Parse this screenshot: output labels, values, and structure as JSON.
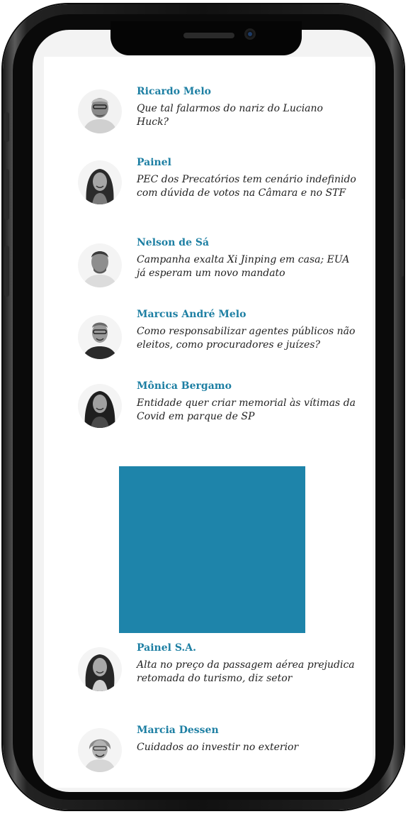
{
  "columnists": [
    {
      "name": "Ricardo Melo",
      "headline": "Que tal falarmos do nariz do Luciano Huck?",
      "avatar_icon": "ricardo-melo-portrait"
    },
    {
      "name": "Painel",
      "headline": "PEC dos Precatórios tem cenário indefinido com dúvida de votos na Câmara e no STF",
      "avatar_icon": "painel-portrait"
    },
    {
      "name": "Nelson de Sá",
      "headline": "Campanha exalta Xi Jinping em casa; EUA já esperam um novo mandato",
      "avatar_icon": "nelson-de-sa-portrait"
    },
    {
      "name": "Marcus André Melo",
      "headline": "Como responsabilizar agentes públicos não eleitos, como procuradores e juízes?",
      "avatar_icon": "marcus-andre-melo-portrait"
    },
    {
      "name": "Mônica Bergamo",
      "headline": "Entidade quer criar memorial às vítimas da Covid em parque de SP",
      "avatar_icon": "monica-bergamo-portrait"
    },
    {
      "name": "Painel S.A.",
      "headline": "Alta no preço da passagem aérea prejudica retomada do turismo, diz setor",
      "avatar_icon": "painel-sa-portrait"
    },
    {
      "name": "Marcia Dessen",
      "headline": "Cuidados ao investir no exterior",
      "avatar_icon": "marcia-dessen-portrait"
    }
  ],
  "colors": {
    "name_link": "#1d7fa3",
    "headline_text": "#222222",
    "ad_block": "#1e84aa",
    "background": "#ffffff"
  }
}
